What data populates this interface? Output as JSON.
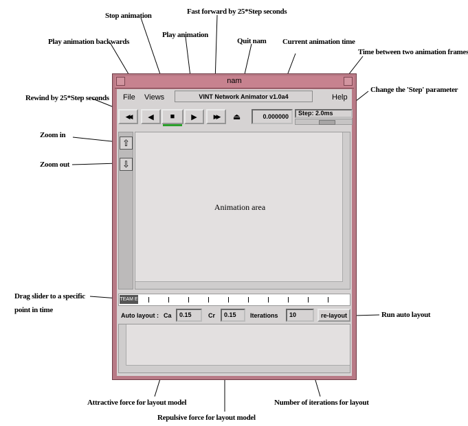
{
  "window": {
    "title": "nam",
    "menu_file": "File",
    "menu_views": "Views",
    "menu_help": "Help",
    "app_title": "VINT Network Animator v1.0a4"
  },
  "controls": {
    "rewind_glyph": "◀◀",
    "back_glyph": "◀",
    "stop_glyph": "■",
    "play_glyph": "▶",
    "ff_glyph": "▶▶",
    "quit_glyph": "⏏",
    "time_value": "0.000000",
    "step_label": "Step: 2.0ms",
    "zoom_in_glyph": "⇧",
    "zoom_out_glyph": "⇩"
  },
  "animation_area_label": "Animation area",
  "timeline": {
    "slider_label": "TEAM E"
  },
  "auto_layout": {
    "label": "Auto layout :",
    "ca_label": "Ca",
    "ca_value": "0.15",
    "cr_label": "Cr",
    "cr_value": "0.15",
    "iterations_label": "Iterations",
    "iterations_value": "10",
    "relayout_label": "re-layout"
  },
  "annotations": {
    "stop_animation": "Stop animation",
    "fast_forward": "Fast forward by 25*Step seconds",
    "play_backwards": "Play animation backwards",
    "play_animation": "Play animation",
    "quit_nam": "Quit nam",
    "current_time": "Current animation time",
    "time_between_frames": "Time between two animation frames",
    "rewind": "Rewind by 25*Step seconds",
    "change_step": "Change the 'Step' parameter",
    "zoom_in": "Zoom in",
    "zoom_out": "Zoom out",
    "drag_slider_1": "Drag slider to a specific",
    "drag_slider_2": "point in time",
    "run_auto_layout": "Run auto layout",
    "attractive_force": "Attractive force for layout model",
    "repulsive_force": "Repulsive force for layout model",
    "num_iterations": "Number of iterations for layout"
  },
  "colors": {
    "window_frame": "#b87a86",
    "panel": "#d6d3d3",
    "play_indicator": "#2aa02a"
  }
}
